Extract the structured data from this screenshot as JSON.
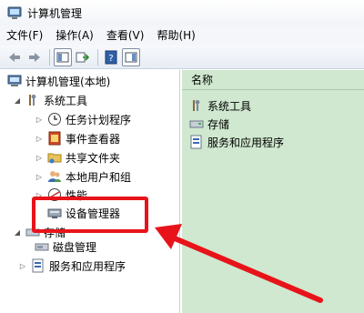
{
  "window": {
    "title": "计算机管理"
  },
  "menubar": {
    "items": [
      "文件(F)",
      "操作(A)",
      "查看(V)",
      "帮助(H)"
    ]
  },
  "toolbar": {
    "buttons": [
      "back-icon",
      "forward-icon",
      "show-hide-tree-icon",
      "export-list-icon",
      "help-icon",
      "show-hide-action-pane-icon"
    ]
  },
  "tree": {
    "root": "计算机管理(本地)",
    "items": [
      {
        "label": "系统工具",
        "icon": "tools-icon"
      },
      {
        "label": "任务计划程序",
        "icon": "clock-icon"
      },
      {
        "label": "事件查看器",
        "icon": "event-viewer-icon"
      },
      {
        "label": "共享文件夹",
        "icon": "shared-folder-icon"
      },
      {
        "label": "本地用户和组",
        "icon": "users-icon"
      },
      {
        "label": "性能",
        "icon": "performance-icon"
      },
      {
        "label": "设备管理器",
        "icon": "device-manager-icon"
      },
      {
        "label": "存储",
        "icon": "storage-icon"
      },
      {
        "label": "磁盘管理",
        "icon": "disk-icon"
      },
      {
        "label": "服务和应用程序",
        "icon": "services-icon"
      }
    ]
  },
  "list": {
    "column_header": "名称",
    "rows": [
      "系统工具",
      "存储",
      "服务和应用程序"
    ]
  },
  "colors": {
    "right_pane_bg": "#cfe8cf",
    "annotation_red": "#e8131a"
  }
}
